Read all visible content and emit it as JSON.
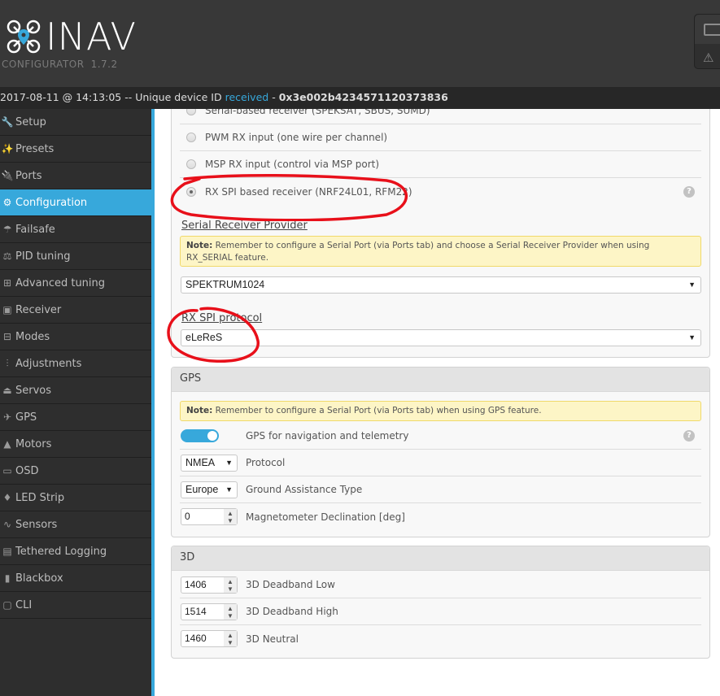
{
  "app": {
    "logo_text": "INAV",
    "subtitle": "CONFIGURATOR",
    "version": "1.7.2"
  },
  "status": {
    "timestamp": "2017-08-11 @ 14:13:05 -- Unique device ID ",
    "received": "received",
    "sep": " - ",
    "device_id": "0x3e002b4234571120373836"
  },
  "sidebar": {
    "items": [
      {
        "label": "Setup",
        "icon": "wrench-icon",
        "glyph": "🔧"
      },
      {
        "label": "Presets",
        "icon": "magic-wand-icon",
        "glyph": "✨"
      },
      {
        "label": "Ports",
        "icon": "plug-icon",
        "glyph": "🔌"
      },
      {
        "label": "Configuration",
        "icon": "gear-icon",
        "glyph": "⚙",
        "active": true
      },
      {
        "label": "Failsafe",
        "icon": "parachute-icon",
        "glyph": "☂"
      },
      {
        "label": "PID tuning",
        "icon": "sitemap-icon",
        "glyph": "⚖"
      },
      {
        "label": "Advanced tuning",
        "icon": "tree-icon",
        "glyph": "⊞"
      },
      {
        "label": "Receiver",
        "icon": "remote-icon",
        "glyph": "▣"
      },
      {
        "label": "Modes",
        "icon": "switches-icon",
        "glyph": "⊟"
      },
      {
        "label": "Adjustments",
        "icon": "sliders-icon",
        "glyph": "⫶"
      },
      {
        "label": "Servos",
        "icon": "servo-icon",
        "glyph": "⏏"
      },
      {
        "label": "GPS",
        "icon": "satellite-icon",
        "glyph": "✈"
      },
      {
        "label": "Motors",
        "icon": "motor-icon",
        "glyph": "▲"
      },
      {
        "label": "OSD",
        "icon": "osd-icon",
        "glyph": "▭"
      },
      {
        "label": "LED Strip",
        "icon": "led-icon",
        "glyph": "♦"
      },
      {
        "label": "Sensors",
        "icon": "pulse-icon",
        "glyph": "∿"
      },
      {
        "label": "Tethered Logging",
        "icon": "logging-icon",
        "glyph": "▤"
      },
      {
        "label": "Blackbox",
        "icon": "chip-icon",
        "glyph": "▮"
      },
      {
        "label": "CLI",
        "icon": "terminal-icon",
        "glyph": "▢"
      }
    ]
  },
  "receiver": {
    "options": [
      {
        "label": "Serial-based receiver (SPEKSAT, SBUS, SUMD)",
        "checked": false
      },
      {
        "label": "PWM RX input (one wire per channel)",
        "checked": false
      },
      {
        "label": "MSP RX input (control via MSP port)",
        "checked": false
      },
      {
        "label": "RX SPI based receiver (NRF24L01, RFM22)",
        "checked": true
      }
    ],
    "serial_provider_label": "Serial Receiver Provider",
    "serial_note_bold": "Note:",
    "serial_note_text": " Remember to configure a Serial Port (via Ports tab) and choose a Serial Receiver Provider when using RX_SERIAL feature.",
    "serial_provider_value": "SPEKTRUM1024",
    "spi_protocol_label": "RX SPI protocol",
    "spi_protocol_value": "eLeReS"
  },
  "gps": {
    "title": "GPS",
    "note_bold": "Note:",
    "note_text": " Remember to configure a Serial Port (via Ports tab) when using GPS feature.",
    "toggle_label": "GPS for navigation and telemetry",
    "toggle_on": true,
    "protocol_value": "NMEA",
    "protocol_label": "Protocol",
    "ground_value": "Europe",
    "ground_label": "Ground Assistance Type",
    "declination_value": "0",
    "declination_label": "Magnetometer Declination [deg]"
  },
  "three_d": {
    "title": "3D",
    "rows": [
      {
        "value": "1406",
        "label": "3D Deadband Low"
      },
      {
        "value": "1514",
        "label": "3D Deadband High"
      },
      {
        "value": "1460",
        "label": "3D Neutral"
      }
    ]
  },
  "icons": {
    "help": "?",
    "arrow": "▼",
    "spin": "▲▼",
    "warning": "⚠"
  },
  "colors": {
    "accent": "#37a8db",
    "annotation": "#e8101a"
  }
}
